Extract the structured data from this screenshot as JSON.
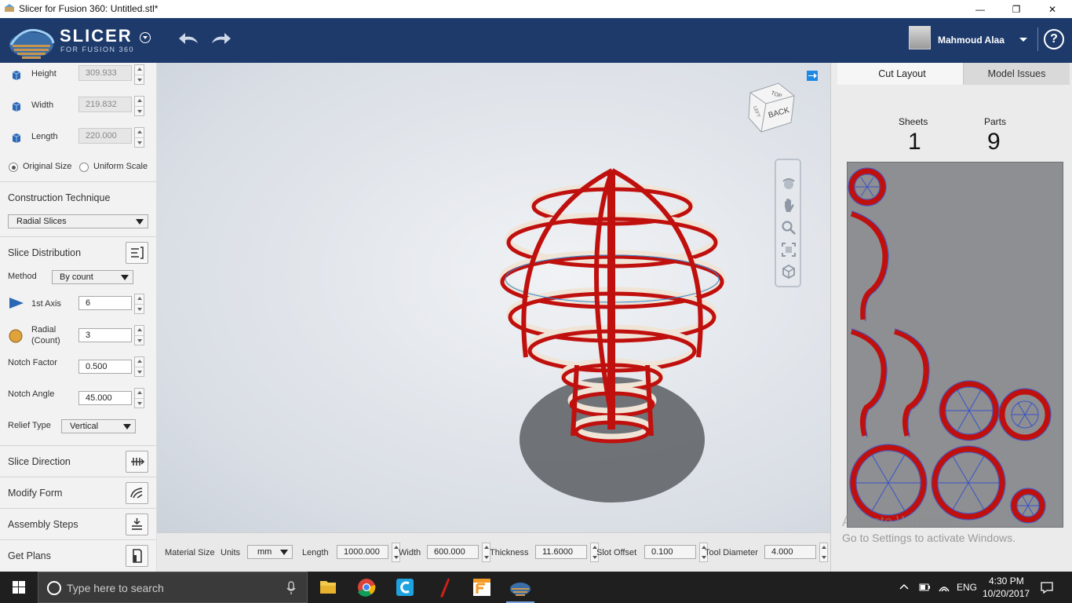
{
  "window": {
    "title": "Slicer for Fusion 360: Untitled.stl*",
    "minimize_glyph": "—",
    "maximize_glyph": "❐",
    "close_glyph": "✕"
  },
  "header": {
    "brand": "SLICER",
    "brand_sub": "FOR FUSION 360",
    "user_name": "Mahmoud Alaa",
    "help_glyph": "?"
  },
  "dimensions": {
    "height_label": "Height",
    "height_value": "309.933",
    "width_label": "Width",
    "width_value": "219.832",
    "length_label": "Length",
    "length_value": "220.000",
    "original_size_label": "Original Size",
    "uniform_scale_label": "Uniform Scale",
    "original_size_selected": true
  },
  "construction": {
    "title": "Construction Technique",
    "technique": "Radial Slices"
  },
  "distribution": {
    "title": "Slice Distribution",
    "method_label": "Method",
    "method_value": "By count",
    "axis1_label": "1st Axis",
    "axis1_value": "6",
    "radial_label_1": "Radial",
    "radial_label_2": "(Count)",
    "radial_value": "3",
    "notch_factor_label": "Notch Factor",
    "notch_factor_value": "0.500",
    "notch_angle_label": "Notch Angle",
    "notch_angle_value": "45.000",
    "relief_type_label": "Relief Type",
    "relief_type_value": "Vertical"
  },
  "tools": {
    "slice_direction": "Slice Direction",
    "modify_form": "Modify Form",
    "assembly_steps": "Assembly Steps",
    "get_plans": "Get Plans"
  },
  "viewcube": {
    "top": "TOP",
    "back": "BACK",
    "left": "LEFT"
  },
  "material": {
    "title": "Material Size",
    "units_label": "Units",
    "units_value": "mm",
    "length_label": "Length",
    "length_value": "1000.000",
    "width_label": "Width",
    "width_value": "600.000",
    "thickness_label": "Thickness",
    "thickness_value": "11.6000",
    "slot_offset_label": "Slot Offset",
    "slot_offset_value": "0.100",
    "tool_diameter_label": "Tool Diameter",
    "tool_diameter_value": "4.000"
  },
  "right": {
    "tab_cut_layout": "Cut Layout",
    "tab_model_issues": "Model Issues",
    "sheets_label": "Sheets",
    "sheets_value": "1",
    "parts_label": "Parts",
    "parts_value": "9",
    "watermark_1": "Activate Windows",
    "watermark_2": "Go to Settings to activate Windows."
  },
  "taskbar": {
    "search_placeholder": "Type here to search",
    "lang": "ENG",
    "time": "4:30 PM",
    "date": "10/20/2017"
  },
  "colors": {
    "header_bg": "#1d3a6b",
    "slice_red": "#c0100e",
    "slice_cream": "#efe4d6",
    "sheet_grey": "#8d8f92",
    "outline_blue": "#3a52c8"
  }
}
